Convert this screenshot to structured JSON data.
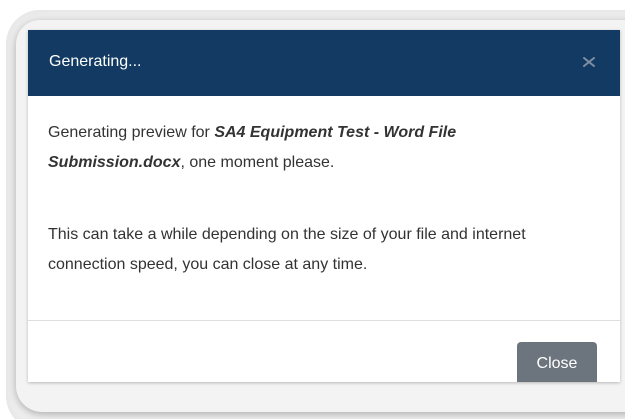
{
  "dialog": {
    "title": "Generating...",
    "close_icon": "close-icon",
    "message_prefix": "Generating preview for ",
    "filename": "SA4 Equipment Test - Word File Submission.docx",
    "message_suffix": ", one moment please.",
    "note": "This can take a while depending on the size of your file and internet connection speed, you can close at any time.",
    "close_label": "Close"
  },
  "colors": {
    "header_bg": "#123a62",
    "button_bg": "#6c757d",
    "text": "#333333"
  }
}
